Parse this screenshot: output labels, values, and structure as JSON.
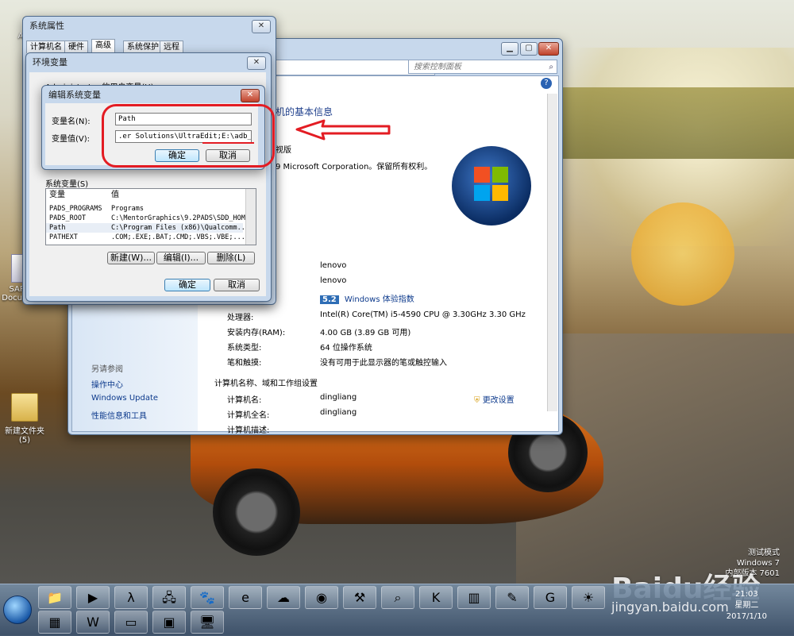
{
  "desktop": {
    "icons": [
      {
        "name": "Adr",
        "label": "Adr"
      },
      {
        "name": "SAP Business Documents",
        "label": "SAP B... Documen..."
      },
      {
        "name": "新建文件夹",
        "label": "新建文件夹 (5)"
      }
    ],
    "watermark": [
      "测试模式",
      "Windows 7",
      "内部版本 7601"
    ],
    "baidu": "Baidu经验",
    "baidu_url": "jingyan.baidu.com"
  },
  "control_panel": {
    "search_placeholder": "搜索控制面板",
    "heading": "机的基本信息",
    "copyright_line1": "视版",
    "copyright_line2": "9 Microsoft Corporation。保留所有权利。",
    "see_also": "另请参阅",
    "links": [
      "操作中心",
      "Windows Update",
      "性能信息和工具"
    ],
    "rows": [
      {
        "label": "",
        "value": "lenovo"
      },
      {
        "label": "",
        "value": "lenovo"
      },
      {
        "label": "处理器:",
        "value": "Intel(R) Core(TM) i5-4590 CPU @ 3.30GHz   3.30 GHz"
      },
      {
        "label": "安装内存(RAM):",
        "value": "4.00 GB (3.89 GB 可用)"
      },
      {
        "label": "系统类型:",
        "value": "64 位操作系统"
      },
      {
        "label": "笔和触摸:",
        "value": "没有可用于此显示器的笔或触控输入"
      }
    ],
    "experience_score": "5.2",
    "experience_label": "Windows 体验指数",
    "section": "计算机名称、域和工作组设置",
    "computer_rows": [
      {
        "label": "计算机名:",
        "value": "dingliang"
      },
      {
        "label": "计算机全名:",
        "value": "dingliang"
      },
      {
        "label": "计算机描述:",
        "value": ""
      }
    ],
    "change_settings": "更改设置"
  },
  "system_properties": {
    "title": "系统属性",
    "tabs": [
      "计算机名",
      "硬件",
      "高级",
      "系统保护",
      "远程"
    ],
    "active_tab": "高级"
  },
  "env_vars": {
    "title": "环境变量",
    "user_vars_label": "Administrator 的用户变量(U)",
    "system_vars_label": "系统变量(S)",
    "columns": [
      "变量",
      "值"
    ],
    "rows": [
      {
        "var": "PADS_PROGRAMS",
        "val": "Programs"
      },
      {
        "var": "PADS_ROOT",
        "val": "C:\\MentorGraphics\\9.2PADS\\SDD_HOME"
      },
      {
        "var": "Path",
        "val": "C:\\Program Files (x86)\\Qualcomm..."
      },
      {
        "var": "PATHEXT",
        "val": ".COM;.EXE;.BAT;.CMD;.VBS;.VBE;..."
      }
    ],
    "buttons": {
      "new": "新建(W)...",
      "edit": "编辑(I)...",
      "delete": "删除(L)"
    },
    "ok": "确定",
    "cancel": "取消"
  },
  "edit_var": {
    "title": "编辑系统变量",
    "name_label": "变量名(N):",
    "value_label": "变量值(V):",
    "name_value": "Path",
    "value_value": ".er Solutions\\UltraEdit;E:\\adb_study",
    "ok": "确定",
    "cancel": "取消"
  },
  "taskbar": {
    "time": "21:03",
    "weekday": "星期二",
    "date": "2017/1/10"
  },
  "colors": {
    "annotation_red": "#e31c23",
    "link_blue": "#0d3a8c"
  }
}
